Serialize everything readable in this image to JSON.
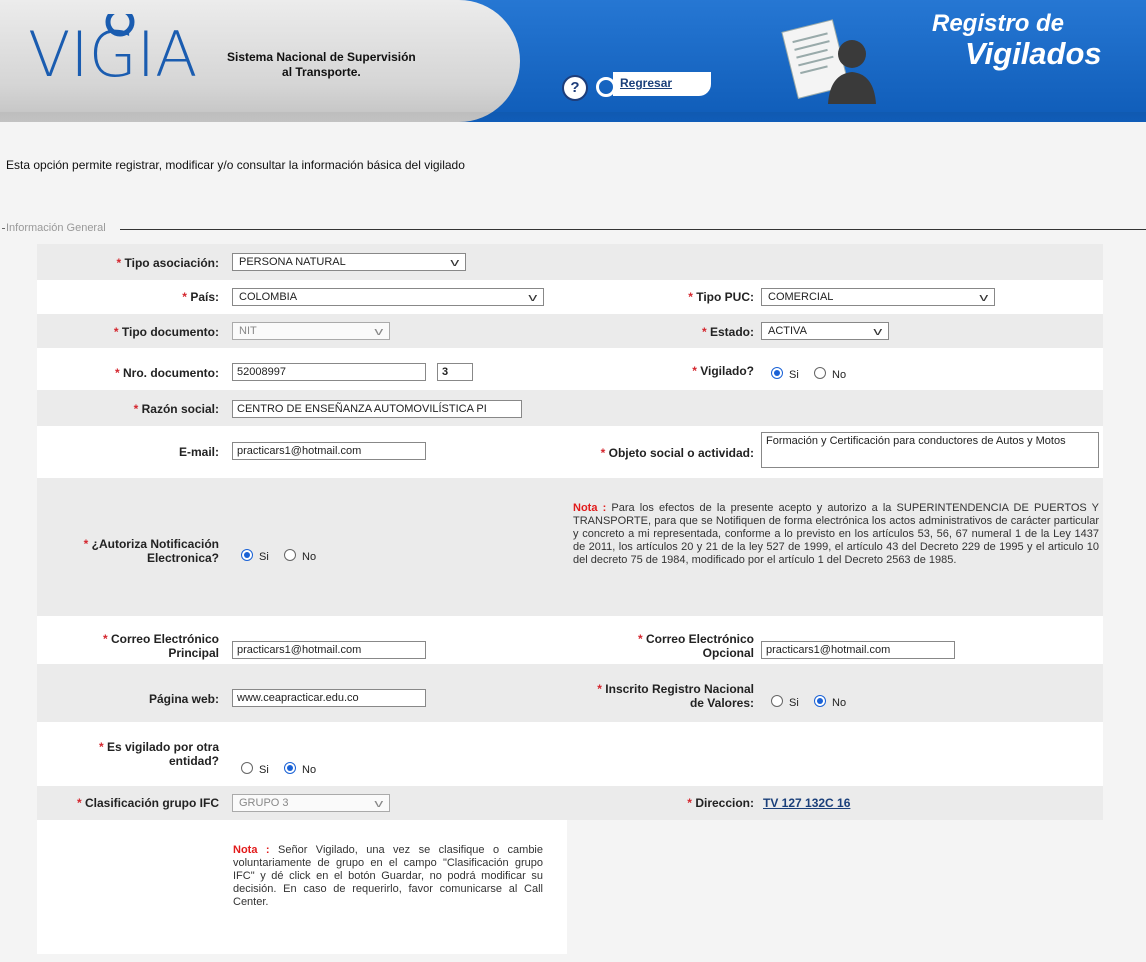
{
  "header": {
    "logo": "VIGIA",
    "subtitle_line1": "Sistema Nacional de Supervisión",
    "subtitle_line2": "al Transporte.",
    "help": "?",
    "back_label": "Regresar",
    "title_line1": "Registro de",
    "title_line2": "Vigilados"
  },
  "intro": "Esta opción permite registrar, modificar y/o consultar la información básica del vigilado",
  "fieldset_legend": "Información General",
  "form": {
    "tipo_asociacion": {
      "label": "Tipo asociación:",
      "value": "PERSONA NATURAL"
    },
    "pais": {
      "label": "País:",
      "value": "COLOMBIA"
    },
    "tipo_puc": {
      "label": "Tipo PUC:",
      "value": "COMERCIAL"
    },
    "tipo_documento": {
      "label": "Tipo documento:",
      "value": "NIT"
    },
    "estado": {
      "label": "Estado:",
      "value": "ACTIVA"
    },
    "nro_documento": {
      "label": "Nro. documento:",
      "value": "52008997",
      "dv": "3"
    },
    "vigilado": {
      "label": "Vigilado?",
      "si": "Si",
      "no": "No",
      "selected": "Si"
    },
    "razon_social": {
      "label": "Razón social:",
      "value": "CENTRO DE ENSEÑANZA AUTOMOVILÍSTICA PI"
    },
    "email": {
      "label": "E-mail:",
      "value": "practicars1@hotmail.com"
    },
    "objeto_social": {
      "label": "Objeto social o actividad:",
      "value": "Formación y Certificación para conductores de Autos y Motos"
    },
    "autoriza": {
      "label_line1": "¿Autoriza Notificación",
      "label_line2": "Electronica?",
      "si": "Si",
      "no": "No",
      "selected": "Si"
    },
    "nota1": {
      "title": "Nota :",
      "text": "Para los efectos de la presente acepto y autorizo a la SUPERINTENDENCIA DE PUERTOS Y TRANSPORTE, para que se Notifiquen de forma electrónica los actos administrativos de carácter particular y concreto a mi representada, conforme a lo previsto en los artículos 53, 56, 67 numeral 1 de la Ley 1437 de 2011, los artículos 20 y 21 de la ley 527 de 1999, el artículo 43 del Decreto 229 de 1995 y el articulo 10 del decreto 75 de 1984, modificado por el artículo 1 del Decreto 2563 de 1985."
    },
    "correo_principal": {
      "label_line1": "Correo Electrónico",
      "label_line2": "Principal",
      "value": "practicars1@hotmail.com"
    },
    "correo_opcional": {
      "label_line1": "Correo Electrónico",
      "label_line2": "Opcional",
      "value": "practicars1@hotmail.com"
    },
    "pagina_web": {
      "label": "Página web:",
      "value": "www.ceapracticar.edu.co"
    },
    "inscrito": {
      "label_line1": "Inscrito Registro Nacional",
      "label_line2": "de Valores:",
      "si": "Si",
      "no": "No",
      "selected": "No"
    },
    "otra_entidad": {
      "label_line1": "Es vigilado por otra",
      "label_line2": "entidad?",
      "si": "Si",
      "no": "No",
      "selected": "No"
    },
    "clasificacion": {
      "label": "Clasificación grupo IFC",
      "value": "GRUPO 3"
    },
    "direccion": {
      "label": "Direccion:",
      "value": "TV 127 132C 16"
    },
    "nota2": {
      "title": "Nota :",
      "text": "Señor Vigilado, una vez se clasifique o cambie voluntariamente de grupo en el campo \"Clasificación grupo IFC\" y dé click en el botón Guardar, no podrá modificar su decisión. En caso de requerirlo, favor comunicarse al Call Center."
    }
  }
}
